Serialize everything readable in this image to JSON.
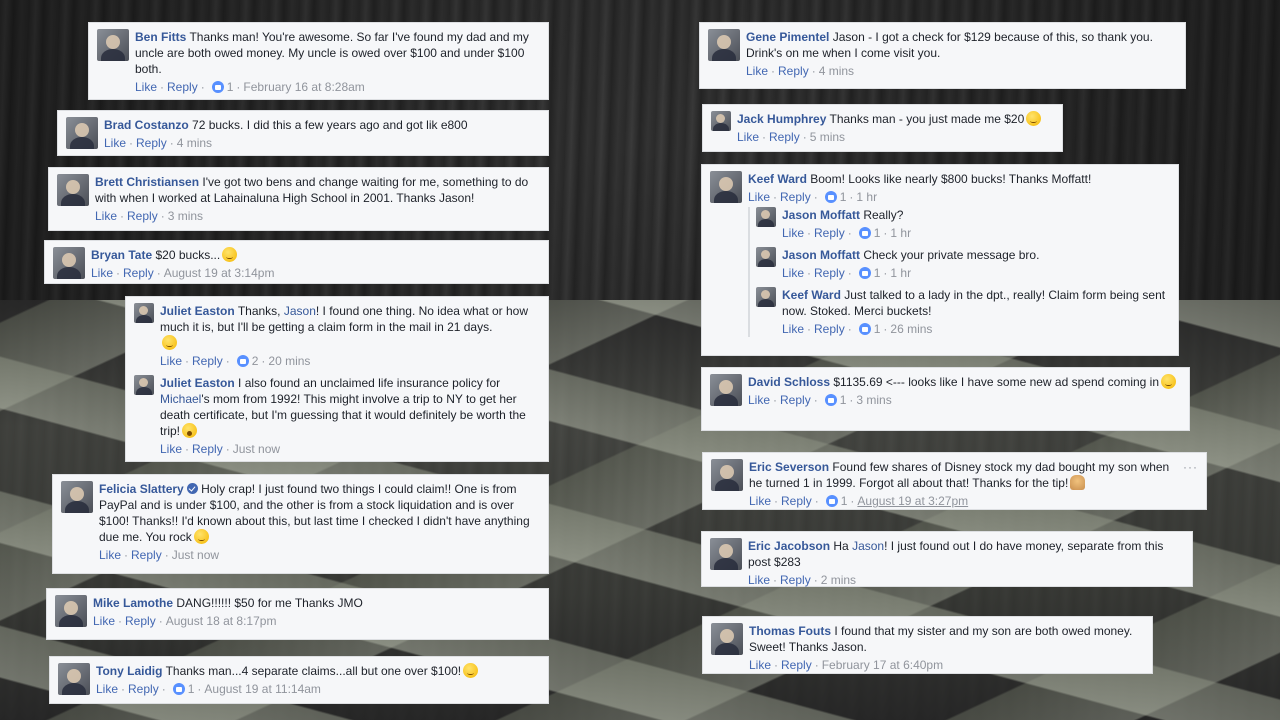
{
  "labels": {
    "like": "Like",
    "reply": "Reply"
  },
  "colors": {
    "name_link": "#365899",
    "meta": "#90949c",
    "card_bg": "#f6f7f9",
    "like_badge": "#5890ff"
  },
  "comments": {
    "ben": {
      "name": "Ben Fitts",
      "text": "Thanks man! You're awesome. So far I've found my dad and my uncle are both owed money. My uncle is owed over $100 and under $100 both.",
      "likes": "1",
      "time": "February 16 at 8:28am"
    },
    "brad": {
      "name": "Brad Costanzo",
      "text": "72 bucks. I did this a few years ago and got lik e800",
      "time": "4 mins"
    },
    "brett": {
      "name": "Brett Christiansen",
      "text": "I've got two bens and change waiting for me, something to do with when I worked at Lahainaluna High School in 2001. Thanks Jason!",
      "time": "3 mins"
    },
    "bryan": {
      "name": "Bryan Tate",
      "text": "$20 bucks...",
      "emoji": "smile-emoji",
      "time": "August 19 at 3:14pm"
    },
    "juliet1": {
      "name": "Juliet Easton",
      "text_a": "Thanks,",
      "tag": "Jason",
      "text_b": "! I found one thing. No idea what or how much it is, but I'll be getting a claim form in the mail in 21 days.",
      "emoji": "smile-emoji",
      "likes": "2",
      "time": "20 mins"
    },
    "juliet2": {
      "name": "Juliet Easton",
      "text_a": "I also found an unclaimed life insurance policy for",
      "tag": "Michael",
      "text_b": "'s mom from 1992! This might involve a trip to NY to get her death certificate, but I'm guessing that it would definitely be worth the trip!",
      "emoji": "wow-emoji",
      "time": "Just now"
    },
    "felicia": {
      "name": "Felicia Slattery",
      "text": "Holy crap! I just found two things I could claim!! One is from PayPal and is under $100, and the other is from a stock liquidation and is over $100! Thanks!! I'd known about this, but last time I checked I didn't have anything due me. You rock",
      "emoji": "smile-emoji",
      "time": "Just now"
    },
    "mike": {
      "name": "Mike Lamothe",
      "text": "DANG!!!!!! $50 for me Thanks JMO",
      "time": "August 18 at 8:17pm"
    },
    "tony": {
      "name": "Tony Laidig",
      "text": "Thanks man...4 separate claims...all but one over $100!",
      "emoji": "grin-emoji",
      "likes": "1",
      "time": "August 19 at 11:14am"
    },
    "gene": {
      "name": "Gene Pimentel",
      "text": "Jason - I got a check for $129 because of this, so thank you. Drink's on me when I come visit you.",
      "time": "4 mins"
    },
    "jack": {
      "name": "Jack Humphrey",
      "text": "Thanks man - you just made me $20",
      "emoji": "smile-emoji",
      "time": "5 mins"
    },
    "keef1": {
      "name": "Keef Ward",
      "text": "Boom! Looks like nearly $800 bucks! Thanks Moffatt!",
      "likes": "1",
      "time": "1 hr"
    },
    "jason1": {
      "name": "Jason Moffatt",
      "text": "Really?",
      "likes": "1",
      "time": "1 hr"
    },
    "jason2": {
      "name": "Jason Moffatt",
      "text": "Check your private message bro.",
      "likes": "1",
      "time": "1 hr"
    },
    "keef2": {
      "name": "Keef Ward",
      "text": "Just talked to a lady in the dpt., really! Claim form being sent now. Stoked. Merci buckets!",
      "likes": "1",
      "time": "26 mins"
    },
    "david": {
      "name": "David Schloss",
      "text": "$1135.69 <--- looks like I have some new ad spend coming in",
      "emoji": "smile-emoji",
      "likes": "1",
      "time": "3 mins"
    },
    "eric_s": {
      "name": "Eric Severson",
      "text": "Found few shares of Disney stock my dad bought my son when he turned 1 in 1999. Forgot all about that! Thanks for the tip!",
      "emoji": "pray-emoji",
      "likes": "1",
      "time": "August 19 at 3:27pm",
      "more": "···"
    },
    "eric_j": {
      "name": "Eric Jacobson",
      "text_a": "Ha",
      "tag": "Jason",
      "text_b": "! I just found out I do have money, separate from this post $283",
      "time": "2 mins"
    },
    "thomas": {
      "name": "Thomas Fouts",
      "text": "I found that my sister and my son are both owed money. Sweet! Thanks Jason.",
      "time": "February 17 at 6:40pm"
    }
  }
}
